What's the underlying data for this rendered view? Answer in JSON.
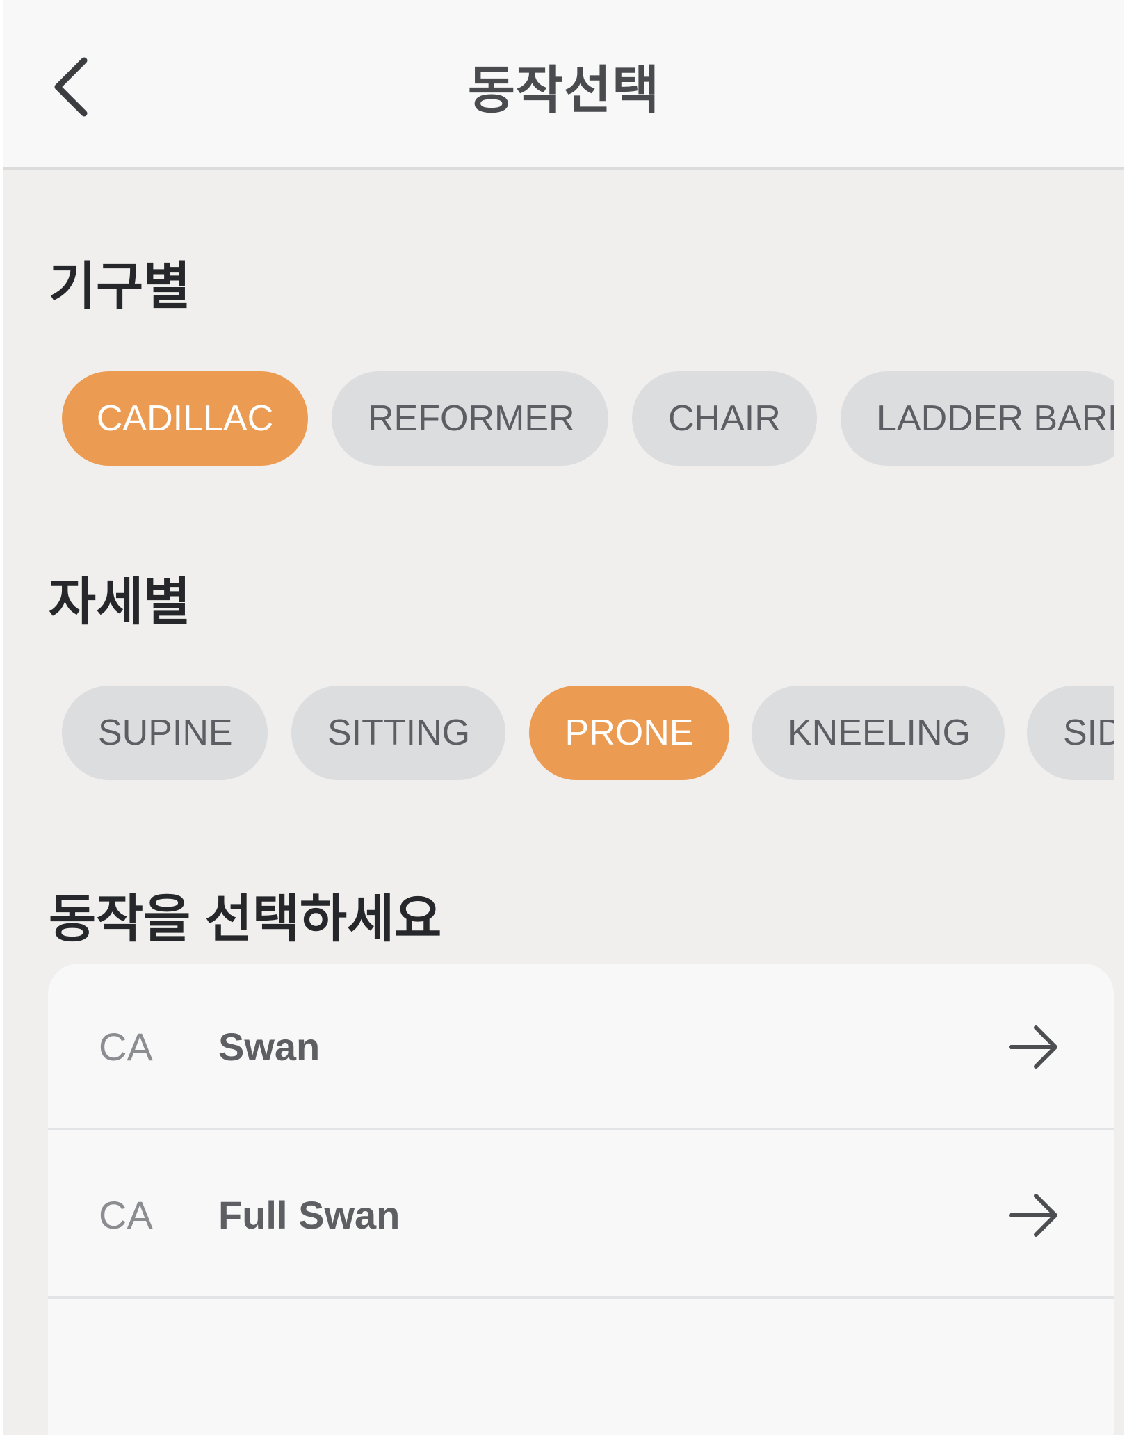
{
  "header": {
    "title": "동작선택",
    "back_icon": "chevron-left-icon"
  },
  "equipment": {
    "title": "기구별",
    "selected": "CADILLAC",
    "chips": [
      {
        "label": "CADILLAC",
        "active": true
      },
      {
        "label": "REFORMER",
        "active": false
      },
      {
        "label": "CHAIR",
        "active": false
      },
      {
        "label": "LADDER BARR",
        "active": false
      }
    ]
  },
  "posture": {
    "title": "자세별",
    "selected": "PRONE",
    "chips": [
      {
        "label": "SUPINE",
        "active": false
      },
      {
        "label": "SITTING",
        "active": false
      },
      {
        "label": "PRONE",
        "active": true
      },
      {
        "label": "KNEELING",
        "active": false
      },
      {
        "label": "SID",
        "active": false
      }
    ]
  },
  "movements": {
    "title": "동작을 선택하세요",
    "arrow_icon": "arrow-right-icon",
    "items": [
      {
        "code": "CA",
        "name": "Swan"
      },
      {
        "code": "CA",
        "name": "Full Swan"
      }
    ]
  },
  "colors": {
    "accent": "#ec9c52",
    "chip_inactive": "#dcdddf",
    "background": "#f1efed"
  }
}
